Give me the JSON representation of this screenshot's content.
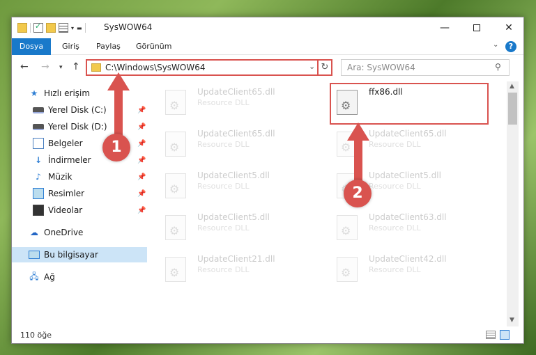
{
  "window": {
    "title": "SysWOW64",
    "controls": {
      "minimize": "—",
      "maximize": "",
      "close": "✕"
    }
  },
  "ribbon": {
    "tabs": [
      "Dosya",
      "Giriş",
      "Paylaş",
      "Görünüm"
    ],
    "help": "?"
  },
  "navbar": {
    "address": "C:\\Windows\\SysWOW64",
    "search_placeholder": "Ara: SysWOW64"
  },
  "sidebar": {
    "items": [
      {
        "label": "Hızlı erişim",
        "icon": "star-icon",
        "pinned": false
      },
      {
        "label": "Yerel Disk (C:)",
        "icon": "disk-icon",
        "pinned": true
      },
      {
        "label": "Yerel Disk (D:)",
        "icon": "disk-icon",
        "pinned": true
      },
      {
        "label": "Belgeler",
        "icon": "document-icon",
        "pinned": true
      },
      {
        "label": "İndirmeler",
        "icon": "download-icon",
        "pinned": true
      },
      {
        "label": "Müzik",
        "icon": "music-icon",
        "pinned": true
      },
      {
        "label": "Resimler",
        "icon": "pictures-icon",
        "pinned": true
      },
      {
        "label": "Videolar",
        "icon": "video-icon",
        "pinned": true
      },
      {
        "label": "OneDrive",
        "icon": "cloud-icon",
        "pinned": false
      },
      {
        "label": "Bu bilgisayar",
        "icon": "computer-icon",
        "pinned": false,
        "selected": true
      },
      {
        "label": "Ağ",
        "icon": "network-icon",
        "pinned": false
      }
    ]
  },
  "files": {
    "left": [
      {
        "name": "UpdateClient65.dll",
        "type": "Resource DLL"
      },
      {
        "name": "UpdateClient65.dll",
        "type": "Resource DLL"
      },
      {
        "name": "UpdateClient5.dll",
        "type": "Resource DLL"
      },
      {
        "name": "UpdateClient5.dll",
        "type": "Resource DLL"
      },
      {
        "name": "UpdateClient21.dll",
        "type": "Resource DLL"
      }
    ],
    "right": [
      {
        "name": "ffx86.dll",
        "type": "",
        "highlighted": true
      },
      {
        "name": "UpdateClient65.dll",
        "type": "Resource DLL"
      },
      {
        "name": "UpdateClient5.dll",
        "type": "Resource DLL"
      },
      {
        "name": "UpdateClient63.dll",
        "type": "Resource DLL"
      },
      {
        "name": "UpdateClient42.dll",
        "type": "Resource DLL"
      }
    ]
  },
  "status": {
    "item_count": "110 öğe"
  },
  "annotations": {
    "step1": "1",
    "step2": "2",
    "color": "#d9534f"
  }
}
